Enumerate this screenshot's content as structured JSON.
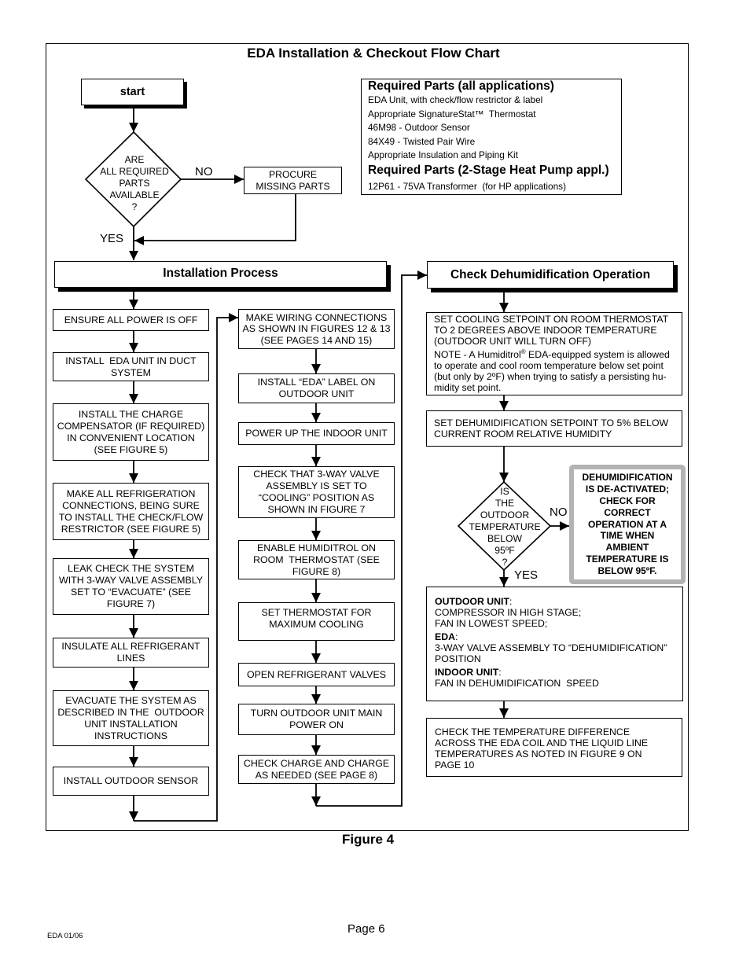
{
  "title": "EDA Installation & Checkout Flow Chart",
  "start": "start",
  "decision_parts": {
    "text": "ARE\nALL REQUIRED\nPARTS\nAVAILABLE\n?",
    "no": "NO",
    "yes": "YES"
  },
  "procure": "PROCURE\nMISSING PARTS",
  "required_parts": {
    "heading_all": "Required Parts (all applications)",
    "items_all": [
      "EDA Unit, with check/flow restrictor & label",
      "Appropriate SignatureStat™  Thermostat",
      "46M98 - Outdoor Sensor",
      "84X49 - Twisted Pair Wire",
      "Appropriate Insulation and Piping Kit"
    ],
    "heading_hp": "Required Parts (2-Stage Heat Pump appl.)",
    "items_hp": [
      "12P61 - 75VA Transformer  (for HP applications)"
    ]
  },
  "installation": {
    "header": "Installation Process",
    "col1": [
      "ENSURE ALL POWER IS OFF",
      "INSTALL  EDA UNIT IN DUCT\nSYSTEM",
      "INSTALL THE CHARGE\nCOMPENSATOR (IF REQUIRED)\nIN CONVENIENT LOCATION\n(SEE FIGURE 5)",
      "MAKE ALL REFRIGERATION\nCONNECTIONS, BEING SURE\nTO INSTALL THE CHECK/FLOW\nRESTRICTOR (SEE FIGURE 5)",
      "LEAK CHECK THE SYSTEM\nWITH 3-WAY VALVE ASSEMBLY\nSET TO “EVACUATE” (SEE\nFIGURE 7)",
      "INSULATE ALL REFRIGERANT\nLINES",
      "EVACUATE THE SYSTEM AS\nDESCRIBED IN THE  OUTDOOR\nUNIT INSTALLATION\nINSTRUCTIONS",
      "INSTALL OUTDOOR SENSOR"
    ],
    "col2": [
      "MAKE WIRING CONNECTIONS\nAS SHOWN IN FIGURES 12 & 13\n(SEE PAGES 14 AND 15)",
      "INSTALL “EDA” LABEL ON\nOUTDOOR UNIT",
      "POWER UP THE INDOOR UNIT",
      "CHECK THAT 3-WAY VALVE\nASSEMBLY IS SET TO\n“COOLING” POSITION AS\nSHOWN IN FIGURE 7",
      "ENABLE HUMIDITROL ON\nROOM  THERMOSTAT (SEE\nFIGURE 8)",
      "SET THERMOSTAT FOR\nMAXIMUM COOLING",
      "OPEN REFRIGERANT VALVES",
      "TURN OUTDOOR UNIT MAIN\nPOWER ON",
      "CHECK CHARGE AND CHARGE\nAS NEEDED (SEE PAGE 8)"
    ]
  },
  "dehumidification": {
    "header": "Check Dehumidification Operation",
    "step1": "SET COOLING SETPOINT ON ROOM THERMOSTAT\nTO 2 DEGREES ABOVE INDOOR TEMPERATURE\n(OUTDOOR UNIT WILL TURN OFF)",
    "note": {
      "before": "NOTE - A Humiditrol",
      "sup": "®",
      "after": " EDA-equipped system is allowed\nto operate and cool room temperature below set point\n(but only by 2ºF) when trying to satisfy a persisting hu-\nmidity set point."
    },
    "step2": "SET DEHUMIDIFICATION SETPOINT TO 5% BELOW\nCURRENT ROOM RELATIVE HUMIDITY",
    "decision": {
      "text": "IS\nTHE\nOUTDOOR\nTEMPERATURE\nBELOW\n95ºF\n?",
      "no": "NO",
      "yes": "YES"
    },
    "deactivated": "DEHUMIDIFICATION\nIS DE-ACTIVATED;\nCHECK FOR\nCORRECT\nOPERATION AT A\nTIME WHEN\nAMBIENT\nTEMPERATURE IS\nBELOW 95ºF.",
    "result": {
      "separator": ":",
      "sections": [
        {
          "label": "OUTDOOR UNIT",
          "text": "COMPRESSOR IN HIGH STAGE;\nFAN IN LOWEST SPEED;"
        },
        {
          "label": "EDA",
          "text": "3-WAY VALVE ASSEMBLY TO “DEHUMIDIFICATION”\nPOSITION"
        },
        {
          "label": "INDOOR UNIT",
          "text": "FAN IN DEHUMIDIFICATION  SPEED"
        }
      ]
    },
    "final": "CHECK THE TEMPERATURE DIFFERENCE\nACROSS THE EDA COIL AND THE LIQUID LINE\nTEMPERATURES AS NOTED IN FIGURE 9 ON\nPAGE 10"
  },
  "figure_caption": "Figure 4",
  "footer": {
    "page": "Page 6",
    "doc_code": "EDA 01/06"
  }
}
